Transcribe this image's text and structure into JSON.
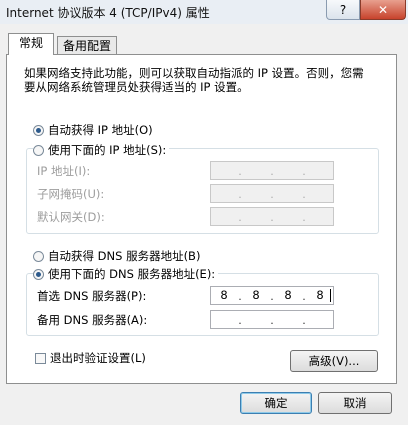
{
  "window": {
    "title": "Internet 协议版本 4 (TCP/IPv4) 属性",
    "help_label": "?",
    "close_label": "✕"
  },
  "tabs": [
    {
      "label": "常规"
    },
    {
      "label": "备用配置"
    }
  ],
  "description": "如果网络支持此功能，则可以获取自动指派的 IP 设置。否则，您需要从网络系统管理员处获得适当的 IP 设置。",
  "ip": {
    "auto_label": "自动获得 IP 地址(O)",
    "manual_label": "使用下面的 IP 地址(S):",
    "selected": "auto",
    "fields": [
      {
        "label": "IP 地址(I):",
        "octets": [
          "",
          "",
          "",
          ""
        ]
      },
      {
        "label": "子网掩码(U):",
        "octets": [
          "",
          "",
          "",
          ""
        ]
      },
      {
        "label": "默认网关(D):",
        "octets": [
          "",
          "",
          "",
          ""
        ]
      }
    ]
  },
  "dns": {
    "auto_label": "自动获得 DNS 服务器地址(B)",
    "manual_label": "使用下面的 DNS 服务器地址(E):",
    "selected": "manual",
    "fields": [
      {
        "label": "首选 DNS 服务器(P):",
        "octets": [
          "8",
          "8",
          "8",
          "8"
        ]
      },
      {
        "label": "备用 DNS 服务器(A):",
        "octets": [
          "",
          "",
          "",
          ""
        ]
      }
    ]
  },
  "validate_label": "退出时验证设置(L)",
  "validate_checked": false,
  "advanced_label": "高级(V)...",
  "ok_label": "确定",
  "cancel_label": "取消"
}
